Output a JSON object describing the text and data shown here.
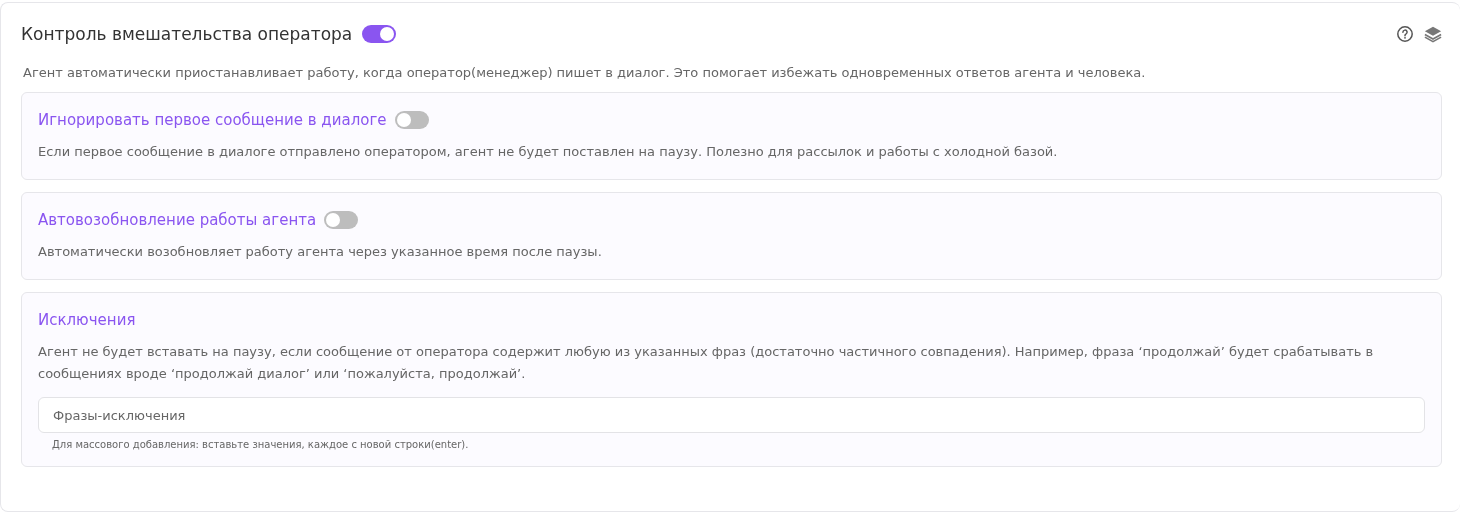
{
  "header": {
    "title": "Контроль вмешательства оператора",
    "on": true
  },
  "description": "Агент автоматически приостанавливает работу, когда оператор(менеджер) пишет в диалог. Это помогает избежать одновременных ответов агента и человека.",
  "sections": [
    {
      "kind": "toggle",
      "title": "Игнорировать первое сообщение в диалоге",
      "on": false,
      "description": "Если первое сообщение в диалоге отправлено оператором, агент не будет поставлен на паузу. Полезно для рассылок и работы с холодной базой."
    },
    {
      "kind": "toggle",
      "title": "Автовозобновление работы агента",
      "on": false,
      "description": "Автоматически возобновляет работу агента через указанное время после паузы."
    },
    {
      "kind": "phrases",
      "title": "Исключения",
      "description": "Агент не будет вставать на паузу, если сообщение от оператора содержит любую из указанных фраз (достаточно частичного совпадения). Например, фраза ‘продолжай’ будет срабатывать в сообщениях вроде ‘продолжай диалог’ или ‘пожалуйста, продолжай’.",
      "placeholder": "Фразы-исключения",
      "hint": "Для массового добавления: вставьте значения, каждое с новой строки(enter)."
    }
  ]
}
